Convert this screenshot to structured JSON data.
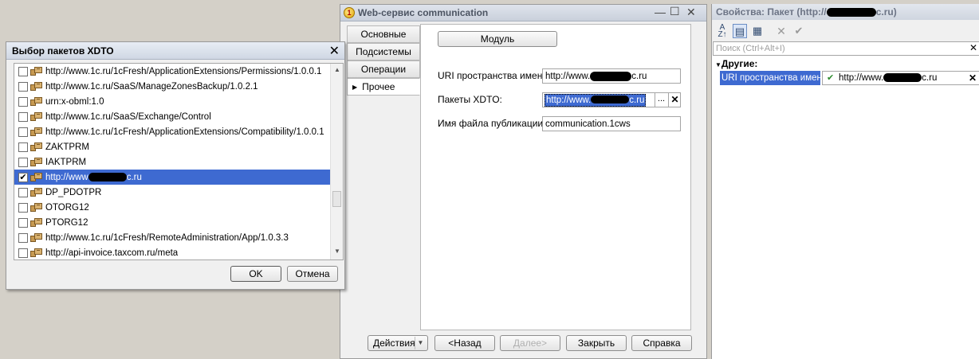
{
  "xdto_dialog": {
    "title": "Выбор пакетов XDTO",
    "items": [
      {
        "label": "http://www.1c.ru/1cFresh/ApplicationExtensions/Permissions/1.0.0.1",
        "checked": false
      },
      {
        "label": "http://www.1c.ru/SaaS/ManageZonesBackup/1.0.2.1",
        "checked": false
      },
      {
        "label": "urn:x-obml:1.0",
        "checked": false
      },
      {
        "label": "http://www.1c.ru/SaaS/Exchange/Control",
        "checked": false
      },
      {
        "label": "http://www.1c.ru/1cFresh/ApplicationExtensions/Compatibility/1.0.0.1",
        "checked": false
      },
      {
        "label": "ZAKTPRM",
        "checked": false
      },
      {
        "label": "IAKTPRM",
        "checked": false
      },
      {
        "label_prefix": "http://www",
        "label_suffix": "c.ru",
        "checked": true,
        "selected": true
      },
      {
        "label": "DP_PDOTPR",
        "checked": false
      },
      {
        "label": "OTORG12",
        "checked": false
      },
      {
        "label": "PTORG12",
        "checked": false
      },
      {
        "label": "http://www.1c.ru/1cFresh/RemoteAdministration/App/1.0.3.3",
        "checked": false
      },
      {
        "label": "http://api-invoice.taxcom.ru/meta",
        "checked": false
      }
    ],
    "ok_label": "OK",
    "cancel_label": "Отмена"
  },
  "ws_window": {
    "title": "Web-сервис communication",
    "tabs": [
      "Основные",
      "Подсистемы",
      "Операции",
      "Прочее"
    ],
    "active_tab": 3,
    "module_label": "Модуль",
    "uri_label": "URI пространства имен:",
    "uri_prefix": "http://www.",
    "uri_suffix": "c.ru",
    "packages_label": "Пакеты XDTO:",
    "packages_prefix": "http://www.",
    "packages_suffix": "c.ru",
    "filename_label": "Имя файла публикации:",
    "filename_value": "communication.1cws",
    "actions_label": "Действия",
    "back_label": "<Назад",
    "next_label": "Далее>",
    "close_label": "Закрыть",
    "help_label": "Справка"
  },
  "props_panel": {
    "title_prefix": "Свойства: Пакет (http://",
    "title_suffix": "c.ru)",
    "search_placeholder": "Поиск (Ctrl+Alt+I)",
    "group_label": "Другие:",
    "property_name": "URI пространства имен",
    "property_prefix": "http://www.",
    "property_suffix": "c.ru"
  }
}
